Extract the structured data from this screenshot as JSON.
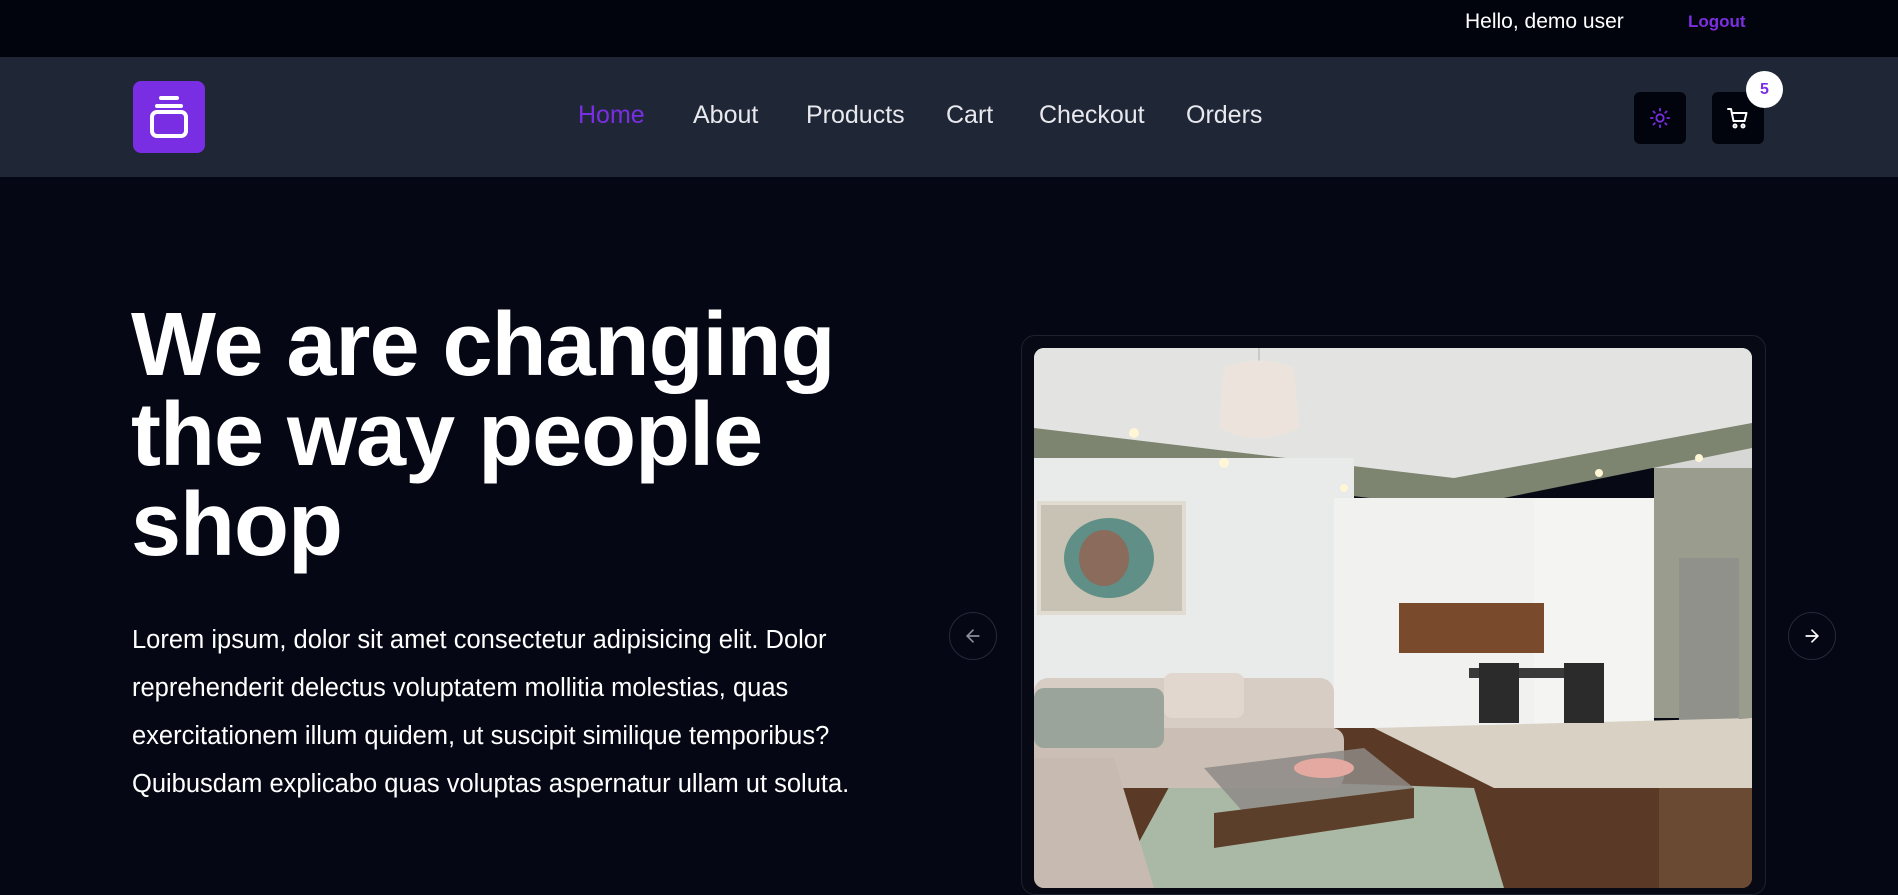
{
  "topbar": {
    "greeting": "Hello, demo user",
    "logout_label": "Logout"
  },
  "nav": {
    "logo_icon": "stacked-box-icon",
    "links": [
      {
        "label": "Home",
        "active": true
      },
      {
        "label": "About",
        "active": false
      },
      {
        "label": "Products",
        "active": false
      },
      {
        "label": "Cart",
        "active": false
      },
      {
        "label": "Checkout",
        "active": false
      },
      {
        "label": "Orders",
        "active": false
      }
    ],
    "theme_toggle_icon": "sun-icon",
    "cart_icon": "cart-icon",
    "cart_count": "5"
  },
  "hero": {
    "title": "We are changing the way people shop",
    "description": "Lorem ipsum, dolor sit amet consectetur adipisicing elit. Dolor reprehenderit delectus voluptatem mollitia molestias, quas exercitationem illum quidem, ut suscipit similique temporibus? Quibusdam explicabo quas voluptas aspernatur ullam ut soluta.",
    "carousel": {
      "prev_icon": "arrow-left-icon",
      "next_icon": "arrow-right-icon"
    }
  },
  "colors": {
    "accent": "#7a2ee3",
    "background": "#050814",
    "navbar": "#1f2736",
    "topbar": "#02040d"
  }
}
